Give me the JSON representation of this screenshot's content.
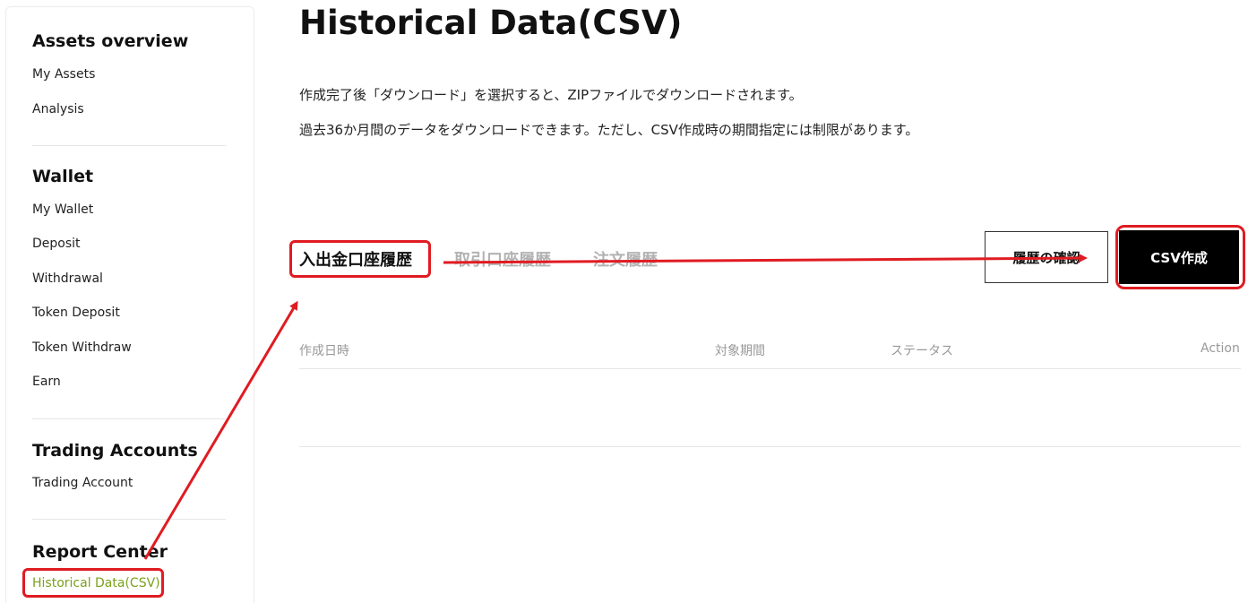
{
  "sidebar": {
    "assets_heading": "Assets overview",
    "assets_items": [
      "My Assets",
      "Analysis"
    ],
    "wallet_heading": "Wallet",
    "wallet_items": [
      "My Wallet",
      "Deposit",
      "Withdrawal",
      "Token Deposit",
      "Token Withdraw",
      "Earn"
    ],
    "trading_heading": "Trading Accounts",
    "trading_items": [
      "Trading Account"
    ],
    "report_heading": "Report Center",
    "report_items": [
      "Historical Data(CSV)"
    ]
  },
  "main": {
    "title": "Historical Data(CSV)",
    "desc_line1": "作成完了後「ダウンロード」を選択すると、ZIPファイルでダウンロードされます。",
    "desc_line2": "過去36か月間のデータをダウンロードできます。ただし、CSV作成時の期間指定には制限があります。",
    "tabs": [
      "入出金口座履歴",
      "取引口座履歴",
      "注文履歴"
    ],
    "history_check_button": "履歴の確認",
    "csv_create_button": "CSV作成",
    "table_headers": [
      "作成日時",
      "対象期間",
      "ステータス",
      "Action"
    ]
  },
  "colors": {
    "accent_active": "#7aa11a",
    "annotation_red": "#e01b22"
  }
}
